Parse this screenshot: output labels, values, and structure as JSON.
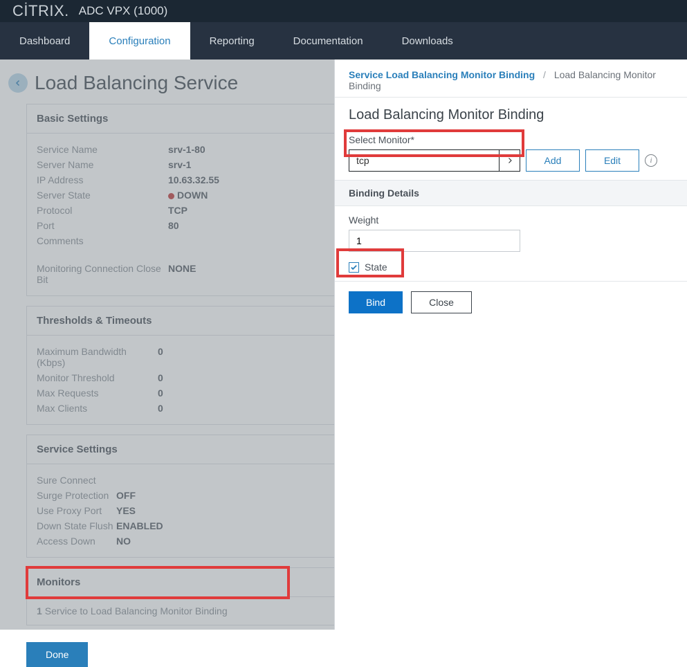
{
  "brand": {
    "logo_a": "CİTR",
    "logo_b": "I",
    "logo_c": "X",
    "product": "ADC VPX (1000)"
  },
  "nav": {
    "dashboard": "Dashboard",
    "configuration": "Configuration",
    "reporting": "Reporting",
    "documentation": "Documentation",
    "downloads": "Downloads"
  },
  "page": {
    "title": "Load Balancing Service",
    "done": "Done"
  },
  "basic": {
    "header": "Basic Settings",
    "rows": {
      "service_name_k": "Service Name",
      "service_name_v": "srv-1-80",
      "server_name_k": "Server Name",
      "server_name_v": "srv-1",
      "ip_k": "IP Address",
      "ip_v": "10.63.32.55",
      "state_k": "Server State",
      "state_v": "DOWN",
      "proto_k": "Protocol",
      "proto_v": "TCP",
      "port_k": "Port",
      "port_v": "80",
      "comments_k": "Comments",
      "comments_v": "",
      "mccb_k": "Monitoring Connection Close Bit",
      "mccb_v": "NONE"
    }
  },
  "thresh": {
    "header": "Thresholds & Timeouts",
    "rows": {
      "mbw_k": "Maximum Bandwidth (Kbps)",
      "mbw_v": "0",
      "mt_k": "Monitor Threshold",
      "mt_v": "0",
      "mr_k": "Max Requests",
      "mr_v": "0",
      "mc_k": "Max Clients",
      "mc_v": "0"
    }
  },
  "svc": {
    "header": "Service Settings",
    "rows": {
      "sc_k": "Sure Connect",
      "sc_v": "",
      "sp_k": "Surge Protection",
      "sp_v": "OFF",
      "upp_k": "Use Proxy Port",
      "upp_v": "YES",
      "dsf_k": "Down State Flush",
      "dsf_v": "ENABLED",
      "ad_k": "Access Down",
      "ad_v": "NO"
    }
  },
  "mon": {
    "header": "Monitors",
    "count": "1",
    "text": "Service to Load Balancing Monitor Binding"
  },
  "side": {
    "crumb_a": "Service Load Balancing Monitor Binding",
    "crumb_b": "Load Balancing Monitor Binding",
    "title": "Load Balancing Monitor Binding",
    "select_label": "Select Monitor*",
    "select_value": "tcp",
    "add": "Add",
    "edit": "Edit",
    "binding_header": "Binding Details",
    "weight_label": "Weight",
    "weight_value": "1",
    "state_label": "State",
    "bind": "Bind",
    "close": "Close"
  }
}
